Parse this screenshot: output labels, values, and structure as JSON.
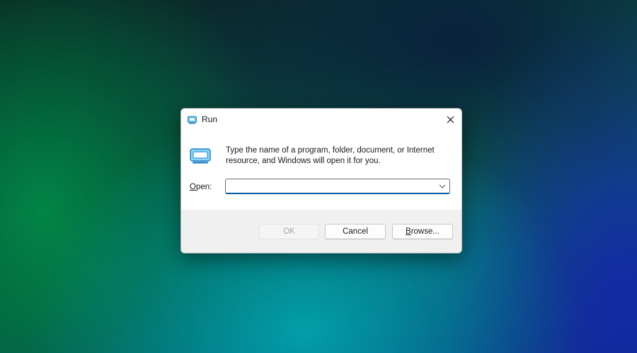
{
  "window": {
    "title": "Run",
    "icon": "run-app-icon",
    "close_icon": "close-icon"
  },
  "content": {
    "icon": "run-app-icon",
    "description": "Type the name of a program, folder, document, or Internet resource, and Windows will open it for you.",
    "open_label_mnemonic": "O",
    "open_label_rest": "pen:",
    "open_value": "",
    "open_placeholder": "",
    "dropdown_icon": "chevron-down-icon"
  },
  "buttons": {
    "ok_label": "OK",
    "ok_enabled": false,
    "cancel_label": "Cancel",
    "browse_mnemonic": "B",
    "browse_rest": "rowse..."
  },
  "colors": {
    "accent": "#005a9e",
    "icon_blue": "#2b9ad8"
  }
}
